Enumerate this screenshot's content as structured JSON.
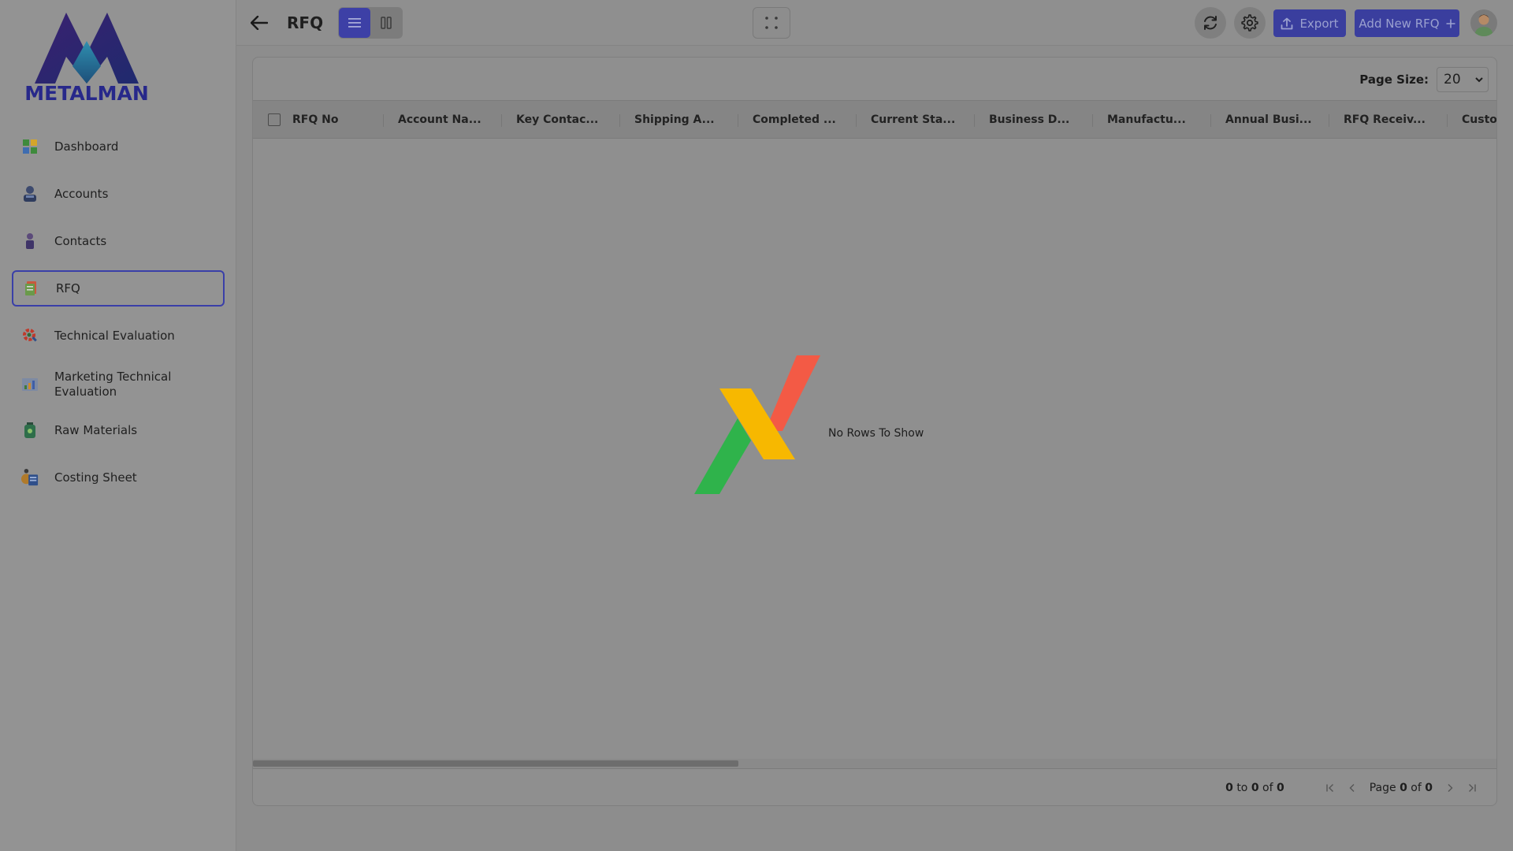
{
  "brand": {
    "logo_text": "METALMAN"
  },
  "sidebar": {
    "items": [
      {
        "label": "Dashboard",
        "icon": "dashboard-icon"
      },
      {
        "label": "Accounts",
        "icon": "accounts-icon"
      },
      {
        "label": "Contacts",
        "icon": "contacts-icon"
      },
      {
        "label": "RFQ",
        "icon": "rfq-icon",
        "active": true
      },
      {
        "label": "Technical Evaluation",
        "icon": "technical-evaluation-icon"
      },
      {
        "label": "Marketing Technical Evaluation",
        "icon": "marketing-chart-icon"
      },
      {
        "label": "Raw Materials",
        "icon": "raw-materials-icon"
      },
      {
        "label": "Costing Sheet",
        "icon": "costing-sheet-icon"
      }
    ]
  },
  "header": {
    "title": "RFQ",
    "export_label": "Export",
    "add_label": "Add New RFQ"
  },
  "grid": {
    "page_size_label": "Page Size:",
    "page_size_value": "20",
    "columns": [
      "RFQ No",
      "Account Na...",
      "Key Contac...",
      "Shipping A...",
      "Completed ...",
      "Current Sta...",
      "Business D...",
      "Manufactu...",
      "Annual Busi...",
      "RFQ Receiv...",
      "Custom"
    ],
    "empty_message": "No Rows To Show",
    "summary": {
      "from": "0",
      "to_word": "to",
      "to": "0",
      "of_word": "of",
      "total": "0"
    },
    "paging": {
      "page_word": "Page",
      "page": "0",
      "of_word": "of",
      "pages": "0"
    }
  },
  "colors": {
    "accent": "#3d40a6",
    "overlay": "#8d8d8d",
    "logo_red": "#f35a45",
    "logo_yellow": "#f7b800",
    "logo_green": "#2fb34b"
  }
}
